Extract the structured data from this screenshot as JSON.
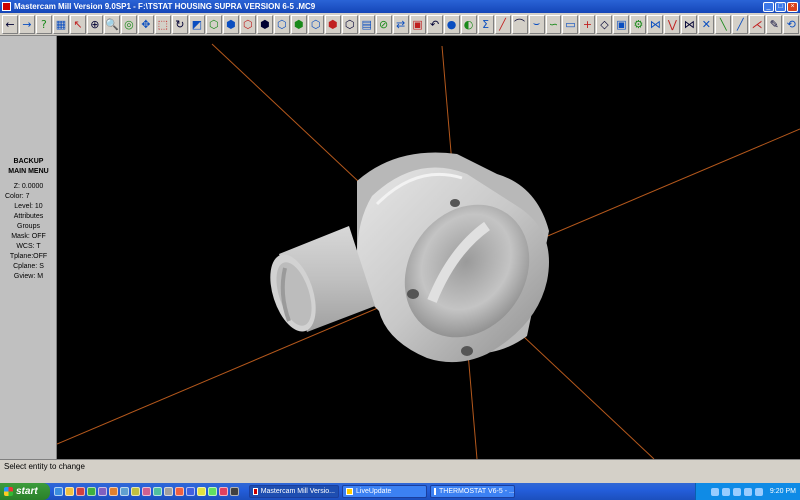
{
  "window": {
    "title": "Mastercam Mill Version 9.0SP1 - F:\\TSTAT HOUSING SUPRA VERSION 6-5 .MC9",
    "min_label": "_",
    "max_label": "□",
    "close_label": "×"
  },
  "toolbar": {
    "buttons": [
      {
        "name": "nav-back-icon",
        "glyph": "←"
      },
      {
        "name": "nav-forward-icon",
        "glyph": "→"
      },
      {
        "name": "help-icon",
        "glyph": "?"
      },
      {
        "name": "calculator-icon",
        "glyph": "▦"
      },
      {
        "name": "analyze-icon",
        "glyph": "↖"
      },
      {
        "name": "zoom-window-icon",
        "glyph": "⊕"
      },
      {
        "name": "zoom-in-icon",
        "glyph": "🔍"
      },
      {
        "name": "zoom-out-icon",
        "glyph": "◎"
      },
      {
        "name": "pan-icon",
        "glyph": "✥"
      },
      {
        "name": "fit-icon",
        "glyph": "⬚"
      },
      {
        "name": "rotate-icon",
        "glyph": "↻"
      },
      {
        "name": "shade-icon",
        "glyph": "◩"
      },
      {
        "name": "view-top-icon",
        "glyph": "⬡"
      },
      {
        "name": "view-front-icon",
        "glyph": "⬢"
      },
      {
        "name": "view-side-icon",
        "glyph": "⬡"
      },
      {
        "name": "view-iso-icon",
        "glyph": "⬢"
      },
      {
        "name": "view-iso2-icon",
        "glyph": "⬡"
      },
      {
        "name": "view-iso3-icon",
        "glyph": "⬢"
      },
      {
        "name": "view-iso4-icon",
        "glyph": "⬡"
      },
      {
        "name": "cube-icon",
        "glyph": "⬢"
      },
      {
        "name": "cube2-icon",
        "glyph": "⬡"
      },
      {
        "name": "screen-icon",
        "glyph": "▤"
      },
      {
        "name": "clear-icon",
        "glyph": "⊘"
      },
      {
        "name": "toolpath-icon",
        "glyph": "⇄"
      },
      {
        "name": "levels-icon",
        "glyph": "▣"
      },
      {
        "name": "undo-icon",
        "glyph": "↶"
      },
      {
        "name": "sphere-icon",
        "glyph": "●"
      },
      {
        "name": "color-icon",
        "glyph": "◐"
      },
      {
        "name": "sigma-icon",
        "glyph": "Σ"
      },
      {
        "name": "line-icon",
        "glyph": "╱"
      },
      {
        "name": "arc-icon",
        "glyph": "⌒"
      },
      {
        "name": "curve-icon",
        "glyph": "⌣"
      },
      {
        "name": "spline-icon",
        "glyph": "∽"
      },
      {
        "name": "rectangle-icon",
        "glyph": "▭"
      },
      {
        "name": "point-icon",
        "glyph": "+"
      },
      {
        "name": "surface-icon",
        "glyph": "◇"
      },
      {
        "name": "solid-icon",
        "glyph": "▣"
      },
      {
        "name": "tools-icon",
        "glyph": "⚙"
      },
      {
        "name": "trim1-icon",
        "glyph": "⋈"
      },
      {
        "name": "trim2-icon",
        "glyph": "⋁"
      },
      {
        "name": "trim3-icon",
        "glyph": "⋈"
      },
      {
        "name": "trim4-icon",
        "glyph": "✕"
      },
      {
        "name": "trim5-icon",
        "glyph": "╲"
      },
      {
        "name": "trim6-icon",
        "glyph": "╱"
      },
      {
        "name": "trim7-icon",
        "glyph": "⋌"
      },
      {
        "name": "edit-icon",
        "glyph": "✎"
      },
      {
        "name": "chain-icon",
        "glyph": "⟲"
      }
    ]
  },
  "leftmenu": {
    "backup": "BACKUP",
    "main_menu": "MAIN MENU",
    "z": "Z:  0.0000",
    "color": "Color:       7",
    "level": "Level:  10",
    "attributes": "Attributes",
    "groups": "Groups",
    "mask": "Mask:  OFF",
    "wcs": "WCS:   T",
    "tplane": "Tplane:OFF",
    "cplane": "Cplane:  S",
    "gview": "Gview:   M"
  },
  "prompt": {
    "text": "Select entity to change"
  },
  "taskbar": {
    "start_label": "start",
    "tasks": [
      {
        "label": "Mastercam Mill Versio...",
        "active": true
      },
      {
        "label": "LiveUpdate",
        "active": false
      },
      {
        "label": "THERMOSTAT V6-5 - ...",
        "active": false
      }
    ],
    "clock": "9:20 PM"
  },
  "colors": {
    "axis": "#b4581c",
    "part": "#c8c8c8",
    "titlebar": "#1f55c9",
    "panel": "#c0c0c0"
  }
}
